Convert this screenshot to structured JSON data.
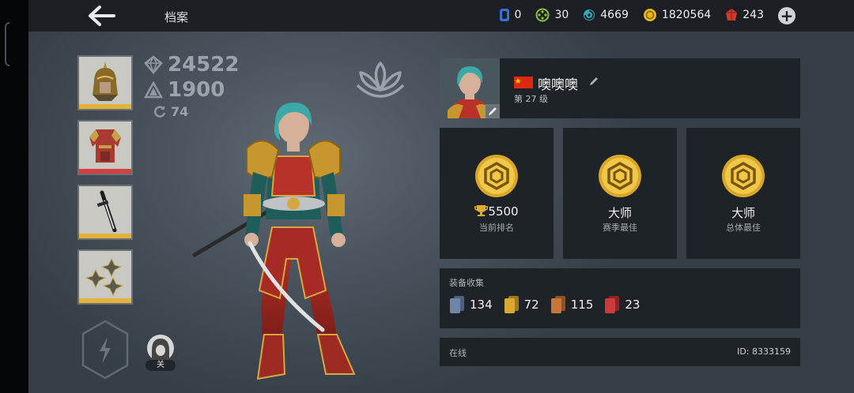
{
  "header": {
    "title": "档案",
    "currencies": [
      {
        "icon": "blue-token-icon",
        "value": "0",
        "color": "#3b6fd4"
      },
      {
        "icon": "green-dice-icon",
        "value": "30",
        "color": "#8bbf3a"
      },
      {
        "icon": "teal-swirl-icon",
        "value": "4669",
        "color": "#2fb0c0"
      },
      {
        "icon": "gold-coin-icon",
        "value": "1820564",
        "color": "#e8b422"
      },
      {
        "icon": "red-gem-icon",
        "value": "243",
        "color": "#d33a2c"
      }
    ]
  },
  "stats": {
    "power": "24522",
    "rating": "1900",
    "upgrades": "74"
  },
  "equipment": [
    {
      "name": "helmet",
      "bar_color": "#e2b23a"
    },
    {
      "name": "armor",
      "bar_color": "#d44040"
    },
    {
      "name": "sword",
      "bar_color": "#e2b23a"
    },
    {
      "name": "shuriken",
      "bar_color": "#e2b23a"
    }
  ],
  "avatar_toggle": {
    "label": "关"
  },
  "profile": {
    "name": "噢噢噢",
    "level": "第 27 级"
  },
  "ranks": [
    {
      "value": "5500",
      "label": "当前排名",
      "has_trophy": true
    },
    {
      "value": "大师",
      "label": "赛季最佳",
      "has_trophy": false
    },
    {
      "value": "大师",
      "label": "总体最佳",
      "has_trophy": false
    }
  ],
  "collection": {
    "header": "装备收集",
    "items": [
      {
        "icon": "card-blue-icon",
        "count": "134",
        "color": "#6f86a8"
      },
      {
        "icon": "card-gold-icon",
        "count": "72",
        "color": "#d8a830"
      },
      {
        "icon": "card-orange-icon",
        "count": "115",
        "color": "#c9763a"
      },
      {
        "icon": "card-red-icon",
        "count": "23",
        "color": "#cc3a3a"
      }
    ]
  },
  "status": {
    "online": "在线",
    "player_id": "ID: 8333159"
  }
}
